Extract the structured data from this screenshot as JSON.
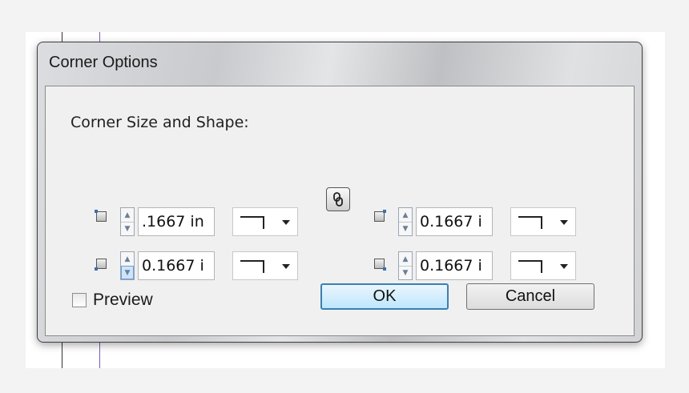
{
  "dialog": {
    "title": "Corner Options",
    "section_label": "Corner Size and Shape:",
    "corners": [
      {
        "id": "top-left",
        "value": "0.1667 in",
        "display": ".1667 in",
        "shape": "fancy"
      },
      {
        "id": "top-right",
        "value": "0.1667 in",
        "display": "0.1667 i",
        "shape": "fancy"
      },
      {
        "id": "bottom-left",
        "value": "0.1667 in",
        "display": "0.1667 i",
        "shape": "fancy"
      },
      {
        "id": "bottom-right",
        "value": "0.1667 in",
        "display": "0.1667 i",
        "shape": "fancy"
      }
    ],
    "link_icon": "chain-link-icon",
    "preview": {
      "label": "Preview",
      "checked": false
    },
    "ok_label": "OK",
    "cancel_label": "Cancel"
  },
  "colors": {
    "ok_border": "#3c7fb1",
    "spinner_active": "#cfe4f7",
    "guide_purple": "#7a5cc0"
  }
}
